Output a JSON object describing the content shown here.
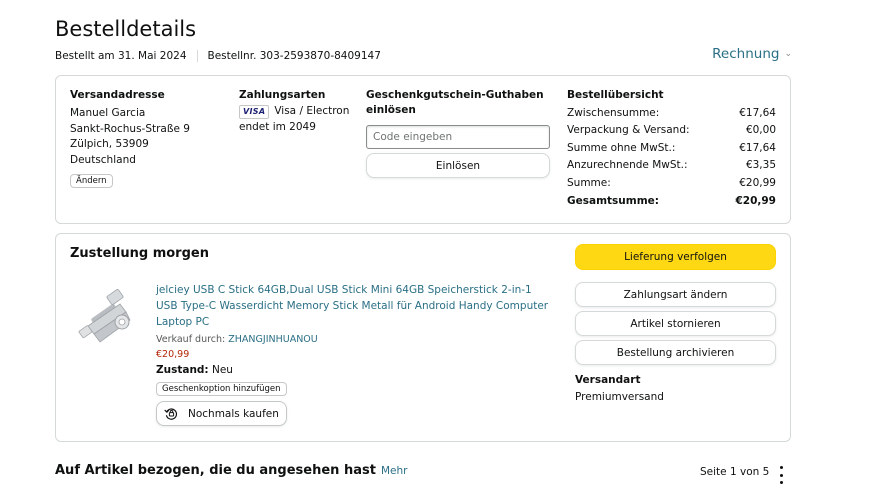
{
  "page": {
    "title": "Bestelldetails",
    "order_date": "Bestellt am 31. Mai 2024",
    "order_number": "Bestellnr. 303-2593870-8409147",
    "invoice_label": "Rechnung"
  },
  "summary": {
    "address": {
      "heading": "Versandadresse",
      "name": "Manuel Garcia",
      "street": "Sankt-Rochus-Straße 9",
      "city": "Zülpich, 53909",
      "country": "Deutschland",
      "change_label": "Ändern"
    },
    "payment": {
      "heading": "Zahlungsarten",
      "card_logo": "VISA",
      "card_type": "Visa / Electron",
      "card_ending": "endet im 2049"
    },
    "gift_card": {
      "heading": "Geschenkgutschein-Guthaben einlösen",
      "placeholder": "Code eingeben",
      "redeem_label": "Einlösen"
    },
    "totals": {
      "heading": "Bestellübersicht",
      "rows": [
        {
          "label": "Zwischensumme:",
          "value": "€17,64"
        },
        {
          "label": "Verpackung & Versand:",
          "value": "€0,00"
        },
        {
          "label": "Summe ohne MwSt.:",
          "value": "€17,64"
        },
        {
          "label": "Anzurechnende MwSt.:",
          "value": "€3,35"
        },
        {
          "label": "Summe:",
          "value": "€20,99"
        }
      ],
      "grand_label": "Gesamtsumme:",
      "grand_value": "€20,99"
    }
  },
  "shipment": {
    "title": "Zustellung morgen",
    "product": {
      "name": "jelciey USB C Stick 64GB,Dual USB Stick Mini 64GB Speicherstick 2-in-1 USB Type-C Wasserdicht Memory Stick Metall für Android Handy Computer Laptop PC",
      "sold_by_label": "Verkauf durch:",
      "seller": "ZHANGJINHUANOU",
      "price": "€20,99",
      "condition_label": "Zustand:",
      "condition": "Neu",
      "gift_option_label": "Geschenkoption hinzufügen",
      "buy_again_label": "Nochmals kaufen"
    },
    "actions": {
      "track": "Lieferung verfolgen",
      "change_payment": "Zahlungsart ändern",
      "cancel_items": "Artikel stornieren",
      "archive": "Bestellung archivieren"
    },
    "shipping_method_heading": "Versandart",
    "shipping_method": "Premiumversand"
  },
  "related": {
    "heading": "Auf Artikel bezogen, die du angesehen hast",
    "more": "Mehr",
    "pager": "Seite 1 von 5"
  },
  "colors": {
    "link": "#2a6f85",
    "primary_button": "#ffd814",
    "price": "#b12704",
    "border": "#d5d9d9"
  }
}
